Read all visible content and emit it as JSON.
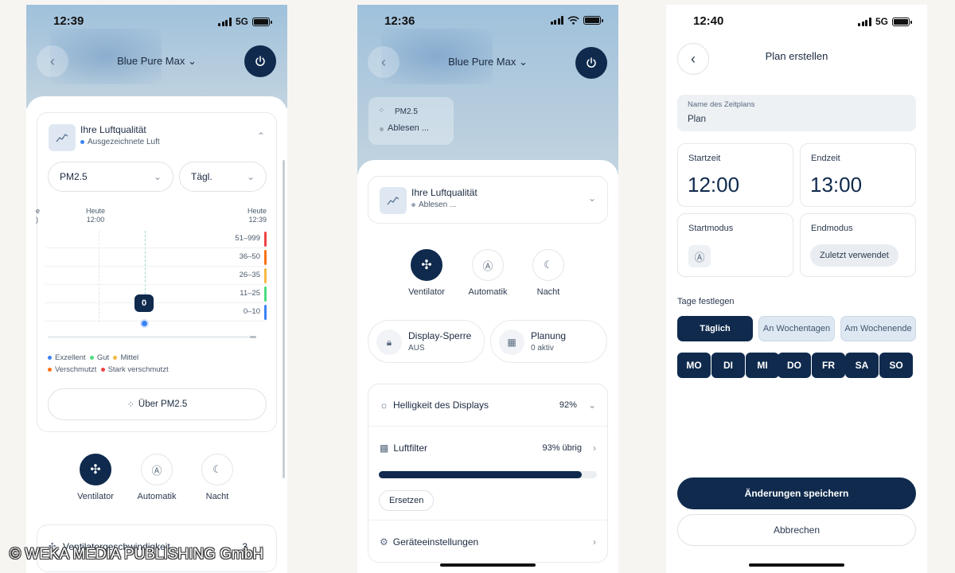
{
  "colors": {
    "navy": "#0f2a4d",
    "excellent": "#3b82f6",
    "good": "#4ade80",
    "medium": "#f5b942",
    "polluted": "#f97316",
    "severe": "#ef4444"
  },
  "screen1": {
    "time": "12:39",
    "network": "5G",
    "device_title": "Blue Pure Max ⌄",
    "air_quality": {
      "title": "Ihre Luftqualität",
      "status": "Ausgezeichnete Luft"
    },
    "pollutant_select": "PM2.5",
    "period_select": "Tägl.",
    "chart": {
      "time_left_partial": "e",
      "time_left_partial2": ")",
      "time_mid_day": "Heute",
      "time_mid_hour": "12:00",
      "time_right_day": "Heute",
      "time_right_hour": "12:39",
      "ranges": [
        "51–999",
        "36–50",
        "26–35",
        "11–25",
        "0–10"
      ],
      "current_value": "0"
    },
    "legend": [
      "Exzellent",
      "Gut",
      "Mittel",
      "Verschmutzt",
      "Stark verschmutzt"
    ],
    "about_button": "Über PM2.5",
    "modes": [
      "Ventilator",
      "Automatik",
      "Nacht"
    ],
    "fan_speed_label": "Ventilatorgeschwindigkeit",
    "fan_speed_value": "3"
  },
  "screen2": {
    "time": "12:36",
    "device_title": "Blue Pure Max ⌄",
    "pm_card": {
      "label": "PM2.5",
      "value": "Ablesen ..."
    },
    "air_quality": {
      "title": "Ihre Luftqualität",
      "status": "Ablesen ..."
    },
    "modes": [
      "Ventilator",
      "Automatik",
      "Nacht"
    ],
    "display_lock": {
      "title": "Display-Sperre",
      "value": "AUS"
    },
    "schedule": {
      "title": "Planung",
      "value": "0 aktiv"
    },
    "brightness": {
      "label": "Helligkeit des Displays",
      "value": "92%"
    },
    "filter": {
      "label": "Luftfilter",
      "value": "93% übrig",
      "progress": 0.93,
      "replace_button": "Ersetzen"
    },
    "settings_label": "Geräteeinstellungen"
  },
  "screen3": {
    "time": "12:40",
    "network": "5G",
    "title": "Plan erstellen",
    "name_field": {
      "label": "Name des Zeitplans",
      "value": "Plan"
    },
    "start_time": {
      "label": "Startzeit",
      "value": "12:00"
    },
    "end_time": {
      "label": "Endzeit",
      "value": "13:00"
    },
    "start_mode": {
      "label": "Startmodus"
    },
    "end_mode": {
      "label": "Endmodus",
      "value": "Zuletzt verwendet"
    },
    "days_heading": "Tage festlegen",
    "day_presets": [
      "Täglich",
      "An Wochentagen",
      "Am Wochenende"
    ],
    "days": [
      "MO",
      "DI",
      "MI",
      "DO",
      "FR",
      "SA",
      "SO"
    ],
    "save_button": "Änderungen speichern",
    "cancel_button": "Abbrechen"
  },
  "watermark": "© WEKA MEDIA PUBLISHING GmbH"
}
